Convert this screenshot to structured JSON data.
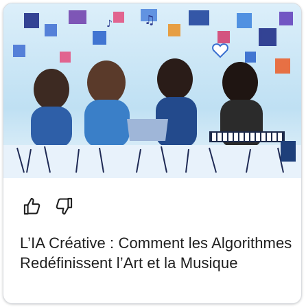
{
  "card": {
    "title": "L’IA Créative : Comment les Algorithmes Redéfinissent l’Art et la Musique",
    "image_alt_icon": "illustration",
    "actions": {
      "like_icon": "thumbs-up-icon",
      "dislike_icon": "thumbs-down-icon"
    }
  },
  "colors": {
    "text": "#1f1f1f",
    "border": "#dadce0",
    "sky": "#cfe7f6",
    "accent_blue": "#1a73e8"
  }
}
